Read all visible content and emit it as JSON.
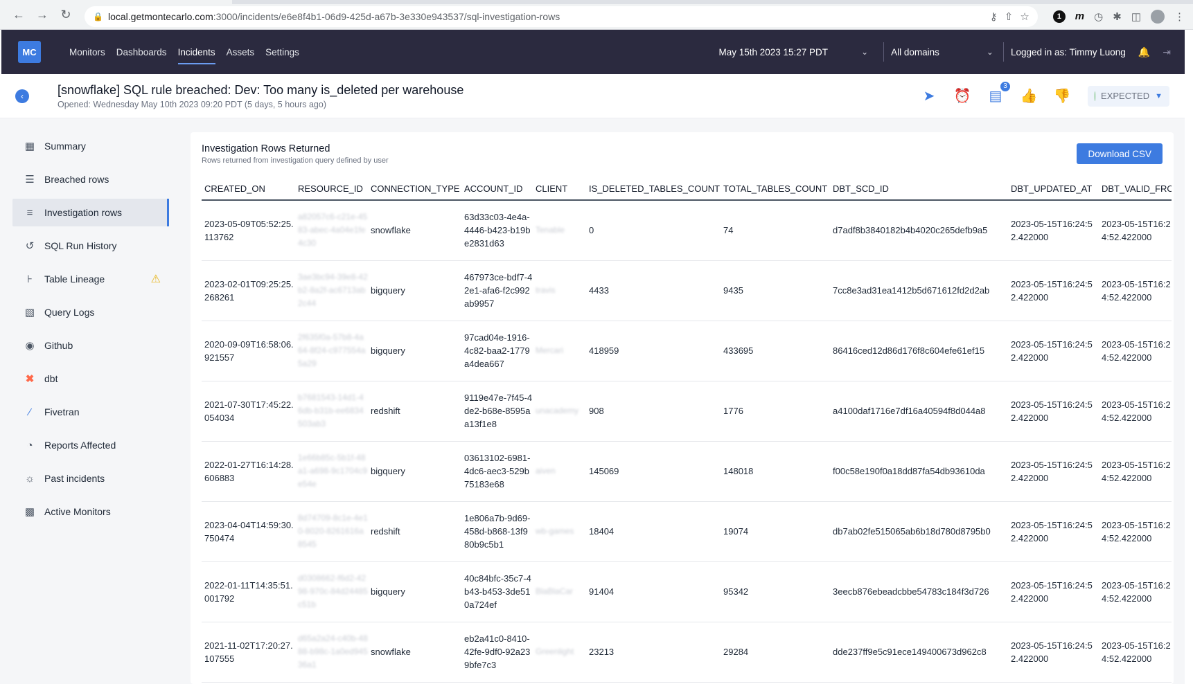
{
  "browser": {
    "url_host": "local.getmontecarlo.com",
    "url_path": ":3000/incidents/e6e8f4b1-06d9-425d-a67b-3e330e943537/sql-investigation-rows",
    "ext_badge": "1",
    "ext_m": "m"
  },
  "header": {
    "logo": "MC",
    "nav": [
      "Monitors",
      "Dashboards",
      "Incidents",
      "Assets",
      "Settings"
    ],
    "date": "May 15th 2023 15:27 PDT",
    "domains": "All domains",
    "logged_in": "Logged in as: Timmy Luong"
  },
  "incident": {
    "title": "[snowflake] SQL rule breached: Dev: Too many is_deleted per warehouse",
    "opened": "Opened: Wednesday May 10th 2023 09:20 PDT (5 days, 5 hours ago)",
    "comment_count": "3",
    "status": "EXPECTED"
  },
  "sidebar": {
    "items": [
      {
        "label": "Summary",
        "icon": "grid-icon"
      },
      {
        "label": "Breached rows",
        "icon": "list-icon"
      },
      {
        "label": "Investigation rows",
        "icon": "search-list-icon"
      },
      {
        "label": "SQL Run History",
        "icon": "history-icon"
      },
      {
        "label": "Table Lineage",
        "icon": "lineage-icon"
      },
      {
        "label": "Query Logs",
        "icon": "query-log-icon"
      },
      {
        "label": "Github",
        "icon": "github-icon"
      },
      {
        "label": "dbt",
        "icon": "dbt-icon"
      },
      {
        "label": "Fivetran",
        "icon": "fivetran-icon"
      },
      {
        "label": "Reports Affected",
        "icon": "pie-chart-icon"
      },
      {
        "label": "Past incidents",
        "icon": "past-incidents-icon"
      },
      {
        "label": "Active Monitors",
        "icon": "monitor-icon"
      }
    ]
  },
  "panel": {
    "title": "Investigation Rows Returned",
    "subtitle": "Rows returned from investigation query defined by user",
    "download": "Download CSV"
  },
  "table": {
    "columns": [
      "CREATED_ON",
      "RESOURCE_ID",
      "CONNECTION_TYPE",
      "ACCOUNT_ID",
      "CLIENT",
      "IS_DELETED_TABLES_COUNT",
      "TOTAL_TABLES_COUNT",
      "DBT_SCD_ID",
      "DBT_UPDATED_AT",
      "DBT_VALID_FROM"
    ],
    "rows": [
      [
        "2023-05-09T05:52:25.113762",
        "a82057c6-c21e-4583-abec-4a04e1fe4c30",
        "snowflake",
        "63d33c03-4e4a-4446-b423-b19be2831d63",
        "Tenable",
        "0",
        "74",
        "d7adf8b3840182b4b4020c265defb9a5",
        "2023-05-15T16:24:52.422000",
        "2023-05-15T16:24:52.422000"
      ],
      [
        "2023-02-01T09:25:25.268261",
        "3ae3bc94-39e8-42b2-8a2f-ac6713ab2c44",
        "bigquery",
        "467973ce-bdf7-42e1-afa6-f2c992ab9957",
        "travis",
        "4433",
        "9435",
        "7cc8e3ad31ea1412b5d671612fd2d2ab",
        "2023-05-15T16:24:52.422000",
        "2023-05-15T16:24:52.422000"
      ],
      [
        "2020-09-09T16:58:06.921557",
        "2f635f0a-57b8-4a64-8f24-c977554a5a29",
        "bigquery",
        "97cad04e-1916-4c82-baa2-1779a4dea667",
        "Mercari",
        "418959",
        "433695",
        "86416ced12d86d176f8c604efe61ef15",
        "2023-05-15T16:24:52.422000",
        "2023-05-15T16:24:52.422000"
      ],
      [
        "2021-07-30T17:45:22.054034",
        "b7681543-14d1-46db-b31b-ee6834503ab3",
        "redshift",
        "9119e47e-7f45-4de2-b68e-8595aa13f1e8",
        "unacademy",
        "908",
        "1776",
        "a4100daf1716e7df16a40594f8d044a8",
        "2023-05-15T16:24:52.422000",
        "2023-05-15T16:24:52.422000"
      ],
      [
        "2022-01-27T16:14:28.606883",
        "1e66b85c-5b1f-48a1-a698-9c1704c9e54e",
        "bigquery",
        "03613102-6981-4dc6-aec3-529b75183e68",
        "aiven",
        "145069",
        "148018",
        "f00c58e190f0a18dd87fa54db93610da",
        "2023-05-15T16:24:52.422000",
        "2023-05-15T16:24:52.422000"
      ],
      [
        "2023-04-04T14:59:30.750474",
        "8d74709-8c1e-4e10-8020-8261616a8545",
        "redshift",
        "1e806a7b-9d69-458d-b868-13f980b9c5b1",
        "wb-games",
        "18404",
        "19074",
        "db7ab02fe515065ab6b18d780d8795b0",
        "2023-05-15T16:24:52.422000",
        "2023-05-15T16:24:52.422000"
      ],
      [
        "2022-01-11T14:35:51.001792",
        "d0308662-f6d2-4298-970c-84d24485c51b",
        "bigquery",
        "40c84bfc-35c7-4b43-b453-3de510a724ef",
        "BlaBlaCar",
        "91404",
        "95342",
        "3eecb876ebeadcbbe54783c184f3d726",
        "2023-05-15T16:24:52.422000",
        "2023-05-15T16:24:52.422000"
      ],
      [
        "2021-11-02T17:20:27.107555",
        "d65a2a24-c40b-4888-b98c-1a0ed94536a1",
        "snowflake",
        "eb2a41c0-8410-42fe-9df0-92a239bfe7c3",
        "Greenlight",
        "23213",
        "29284",
        "dde237ff9e5c91ece149400673d962c8",
        "2023-05-15T16:24:52.422000",
        "2023-05-15T16:24:52.422000"
      ]
    ]
  }
}
